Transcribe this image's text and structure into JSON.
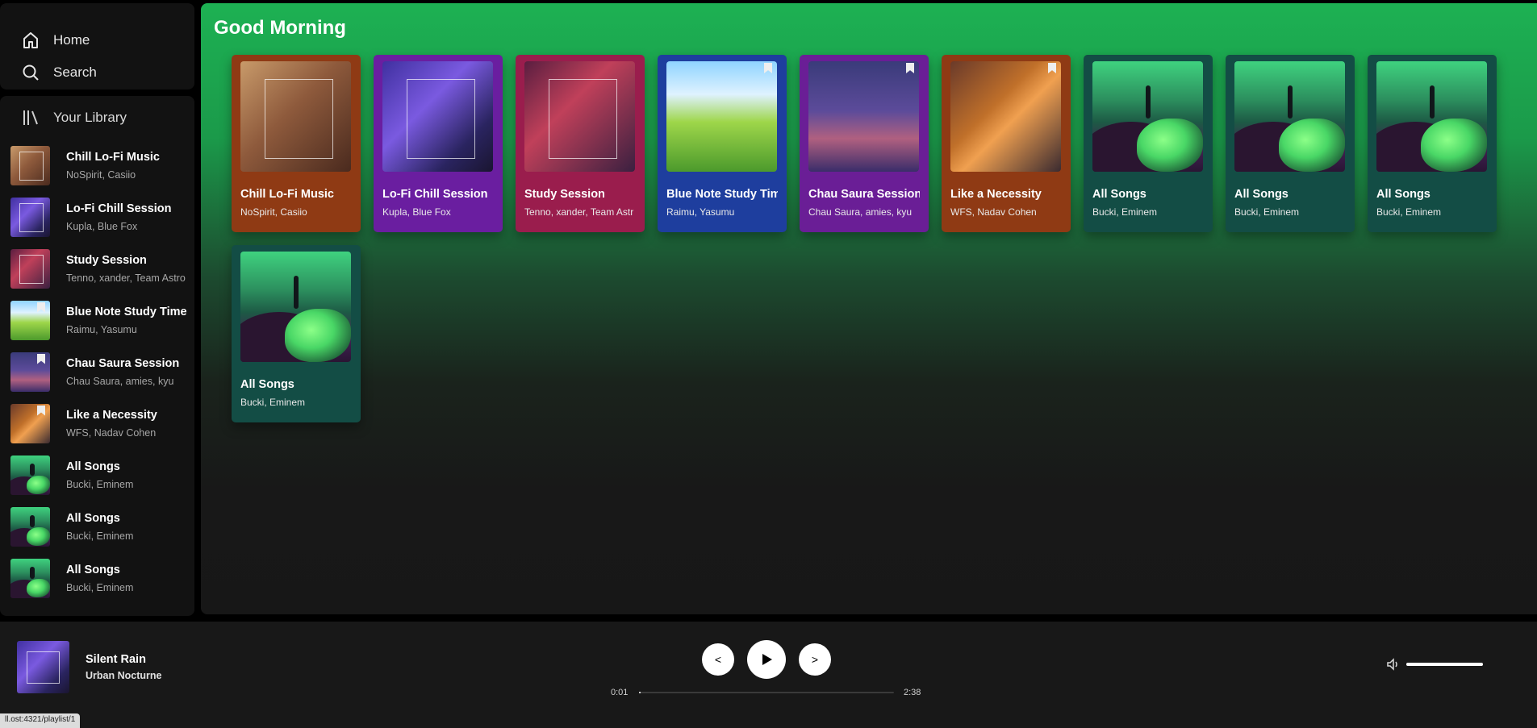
{
  "nav": {
    "home": "Home",
    "search": "Search"
  },
  "library": {
    "title": "Your Library",
    "items": [
      {
        "title": "Chill Lo-Fi Music",
        "subtitle": "NoSpirit, Casiio",
        "art": "lofi1"
      },
      {
        "title": "Lo-Fi Chill Session",
        "subtitle": "Kupla, Blue Fox",
        "art": "lofi2"
      },
      {
        "title": "Study Session",
        "subtitle": "Tenno, xander, Team Astro",
        "art": "study"
      },
      {
        "title": "Blue Note Study Time",
        "subtitle": "Raimu, Yasumu",
        "art": "blue"
      },
      {
        "title": "Chau Saura Session",
        "subtitle": "Chau Saura, amies, kyu",
        "art": "chau"
      },
      {
        "title": "Like a Necessity",
        "subtitle": "WFS, Nadav Cohen",
        "art": "neces"
      },
      {
        "title": "All Songs",
        "subtitle": "Bucki, Eminem",
        "art": "green"
      },
      {
        "title": "All Songs",
        "subtitle": "Bucki, Eminem",
        "art": "green"
      },
      {
        "title": "All Songs",
        "subtitle": "Bucki, Eminem",
        "art": "green"
      }
    ]
  },
  "main": {
    "greeting": "Good Morning",
    "cards": [
      {
        "title": "Chill Lo-Fi Music",
        "subtitle": "NoSpirit, Casiio",
        "art": "lofi1",
        "color": "#8f3a14"
      },
      {
        "title": "Lo-Fi Chill Session",
        "subtitle": "Kupla, Blue Fox",
        "art": "lofi2",
        "color": "#6a1ea0"
      },
      {
        "title": "Study Session",
        "subtitle": "Tenno, xander, Team Astr",
        "art": "study",
        "color": "#9a1d4d"
      },
      {
        "title": "Blue Note Study Time",
        "subtitle": "Raimu, Yasumu",
        "art": "blue",
        "color": "#1e3e9e"
      },
      {
        "title": "Chau Saura Session",
        "subtitle": "Chau Saura, amies, kyu",
        "art": "chau",
        "color": "#6a1e96"
      },
      {
        "title": "Like a Necessity",
        "subtitle": "WFS, Nadav Cohen",
        "art": "neces",
        "color": "#8f3a14"
      },
      {
        "title": "All Songs",
        "subtitle": "Bucki, Eminem",
        "art": "green",
        "color": "#134d45"
      },
      {
        "title": "All Songs",
        "subtitle": "Bucki, Eminem",
        "art": "green",
        "color": "#134d45"
      },
      {
        "title": "All Songs",
        "subtitle": "Bucki, Eminem",
        "art": "green",
        "color": "#134d45"
      },
      {
        "title": "All Songs",
        "subtitle": "Bucki, Eminem",
        "art": "green",
        "color": "#134d45"
      }
    ]
  },
  "player": {
    "title": "Silent Rain",
    "artist": "Urban Nocturne",
    "prev": "<",
    "next": ">",
    "elapsed": "0:01",
    "duration": "2:38",
    "progress": 0.006,
    "volume": 1.0
  },
  "status_url": "ll.ost:4321/playlist/1"
}
